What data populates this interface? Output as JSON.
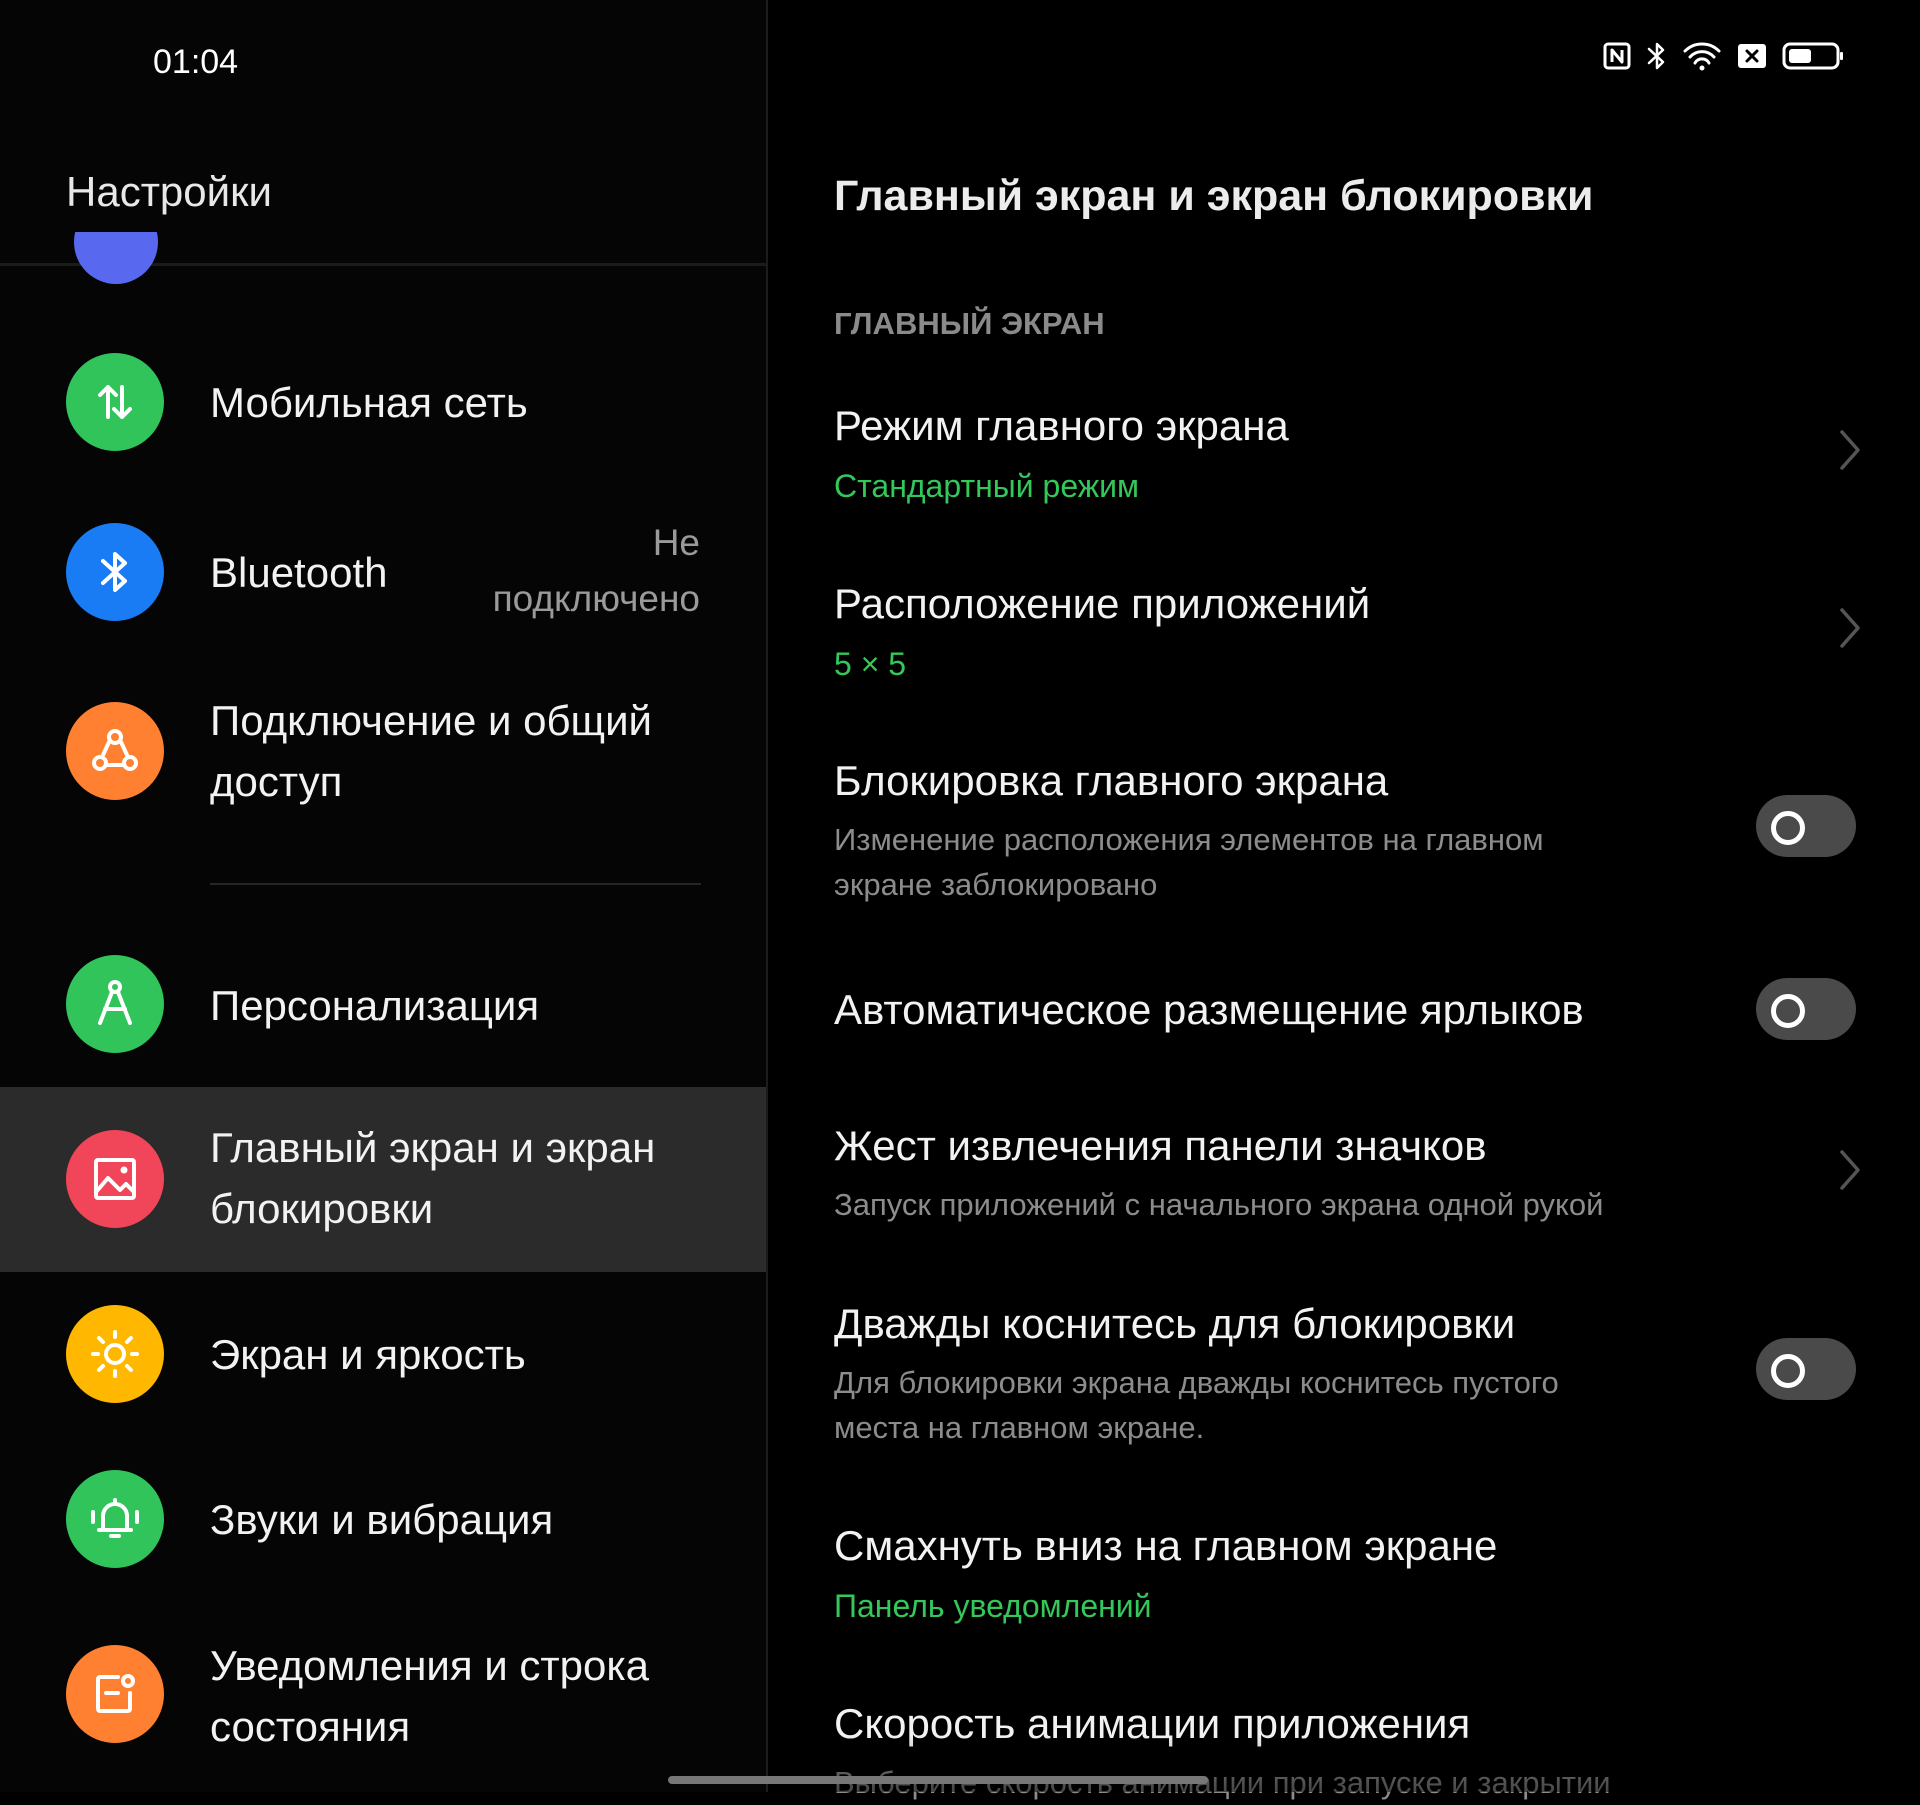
{
  "status_bar": {
    "time": "01:04",
    "icons": [
      "nfc-icon",
      "bluetooth-icon",
      "wifi-icon",
      "sim-off-icon",
      "battery-icon"
    ],
    "battery_level": 0.5
  },
  "left": {
    "title": "Настройки",
    "items": [
      {
        "label": "Мобильная сеть",
        "icon": "mobile-data-icon",
        "color": "#30c45a"
      },
      {
        "label": "Bluetooth",
        "status_line1": "Не",
        "status_line2": "подключено",
        "icon": "bluetooth-icon",
        "color": "#1a7cf5"
      },
      {
        "label_line1": "Подключение и общий",
        "label_line2": "доступ",
        "icon": "connection-sharing-icon",
        "color": "#ff8030"
      },
      {
        "label": "Персонализация",
        "icon": "personalization-icon",
        "color": "#30c45a"
      },
      {
        "label_line1": "Главный экран и экран",
        "label_line2": "блокировки",
        "icon": "wallpaper-icon",
        "color": "#f1465a",
        "selected": true
      },
      {
        "label": "Экран и яркость",
        "icon": "brightness-icon",
        "color": "#ffb700"
      },
      {
        "label": "Звуки и вибрация",
        "icon": "bell-icon",
        "color": "#30c45a"
      },
      {
        "label_line1": "Уведомления и строка",
        "label_line2": "состояния",
        "icon": "notification-icon",
        "color": "#ff8030"
      }
    ]
  },
  "right": {
    "title": "Главный экран и экран блокировки",
    "section": "ГЛАВНЫЙ ЭКРАН",
    "settings": [
      {
        "title": "Режим главного экрана",
        "value": "Стандартный режим",
        "control": "chevron"
      },
      {
        "title": "Расположение приложений",
        "value": "5 × 5",
        "control": "chevron"
      },
      {
        "title": "Блокировка главного экрана",
        "sub_line1": "Изменение расположения элементов на главном",
        "sub_line2": "экране заблокировано",
        "control": "toggle",
        "on": false
      },
      {
        "title": "Автоматическое размещение ярлыков",
        "control": "toggle",
        "on": false
      },
      {
        "title": "Жест извлечения панели значков",
        "sub_line1": "Запуск приложений с начального экрана одной рукой",
        "control": "chevron"
      },
      {
        "title": "Дважды коснитесь для блокировки",
        "sub_line1": "Для блокировки экрана дважды коснитесь пустого",
        "sub_line2": "места на главном экране.",
        "control": "toggle",
        "on": false
      },
      {
        "title": "Смахнуть вниз на главном экране",
        "value": "Панель уведомлений",
        "control": "none"
      },
      {
        "title": "Скорость анимации приложения",
        "sub_line1": "Выберите скорость анимации при запуске и закрытии",
        "control": "none"
      }
    ]
  },
  "colors": {
    "accent_green": "#34c759",
    "background": "#000000",
    "selected_row": "#2b2b2b",
    "toggle_off": "#4a4a4a"
  }
}
